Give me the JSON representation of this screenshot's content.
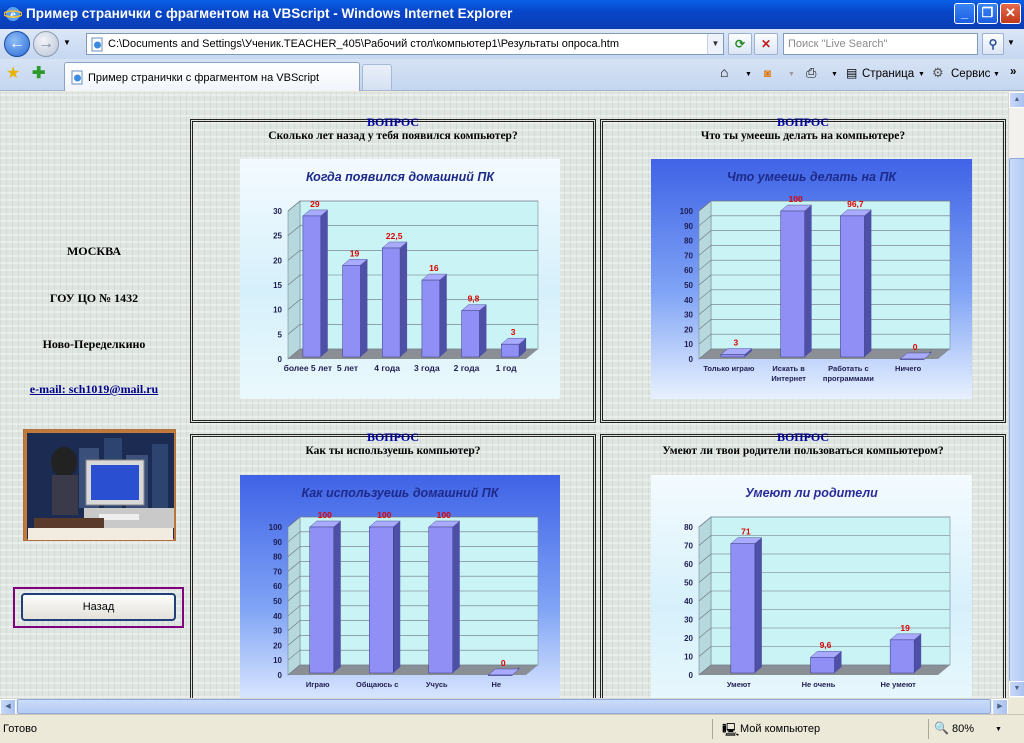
{
  "window": {
    "title": "Пример странички с фрагментом на VBScript - Windows Internet Explorer",
    "address": "C:\\Documents and Settings\\Ученик.TEACHER_405\\Рабочий стол\\компьютер1\\Результаты опроса.htm",
    "search_placeholder": "Поиск \"Live Search\"",
    "tab_label": "Пример странички с фрагментом на VBScript",
    "toolbar_page": "Страница",
    "toolbar_service": "Сервис"
  },
  "left": {
    "city": "МОСКВА",
    "school": "ГОУ ЦО № 1432",
    "district": "Ново-Переделкино",
    "email": "e-mail: sch1019@mail.ru",
    "back_button": "Назад"
  },
  "panels": [
    {
      "heading": "ВОПРОС",
      "question": "Сколько лет назад у тебя появился компьютер?"
    },
    {
      "heading": "ВОПРОС",
      "question": "Что ты умеешь делать на компьютере?"
    },
    {
      "heading": "ВОПРОС",
      "question": "Как ты используешь компьютер?"
    },
    {
      "heading": "ВОПРОС",
      "question": "Умеют ли твои родители пользоваться компьютером?"
    }
  ],
  "status": {
    "text": "Готово",
    "zone": "Мой компьютер",
    "zoom": "80%"
  },
  "chart_data": [
    {
      "type": "bar",
      "title": "Когда появился домашний ПК",
      "categories": [
        "более 5 лет",
        "5 лет",
        "4 года",
        "3 года",
        "2 года",
        "1 год"
      ],
      "values": [
        29,
        19,
        22.5,
        16,
        9.8,
        3
      ],
      "value_labels": [
        "29",
        "19",
        "22,5",
        "16",
        "9,8",
        "3"
      ],
      "yticks": [
        "0",
        "5",
        "10",
        "15",
        "20",
        "25",
        "30"
      ],
      "ylim": [
        0,
        30
      ],
      "background": "#e8f7fb",
      "title_color": "#1e2a8a"
    },
    {
      "type": "bar",
      "title": "Что умеешь делать на ПК",
      "categories": [
        "Только играю",
        "Искать в Интернет",
        "Работать с программами",
        "Ничего"
      ],
      "values": [
        3,
        100,
        96.7,
        0
      ],
      "value_labels": [
        "3",
        "100",
        "96,7",
        "0"
      ],
      "yticks": [
        "0",
        "10",
        "20",
        "30",
        "40",
        "50",
        "60",
        "70",
        "80",
        "90",
        "100"
      ],
      "ylim": [
        0,
        100
      ],
      "background": "#4d78ee",
      "title_color": "#1e2a8a"
    },
    {
      "type": "bar",
      "title": "Как используешь домашний ПК",
      "categories": [
        "Играю",
        "Общаюсь с",
        "Учусь",
        "Не"
      ],
      "values": [
        100,
        100,
        100,
        0
      ],
      "value_labels": [
        "100",
        "100",
        "100",
        "0"
      ],
      "yticks": [
        "0",
        "10",
        "20",
        "30",
        "40",
        "50",
        "60",
        "70",
        "80",
        "90",
        "100"
      ],
      "ylim": [
        0,
        100
      ],
      "background": "#4d78ee",
      "title_color": "#1e2a8a"
    },
    {
      "type": "bar",
      "title": "Умеют ли родители",
      "categories": [
        "Умеют",
        "Не очень",
        "Не умеют"
      ],
      "values": [
        71,
        9.6,
        19
      ],
      "value_labels": [
        "71",
        "9,6",
        "19"
      ],
      "yticks": [
        "0",
        "10",
        "20",
        "30",
        "40",
        "50",
        "60",
        "70",
        "80"
      ],
      "ylim": [
        0,
        80
      ],
      "background": "#eef3fb",
      "title_color": "#2a2a9a"
    }
  ]
}
